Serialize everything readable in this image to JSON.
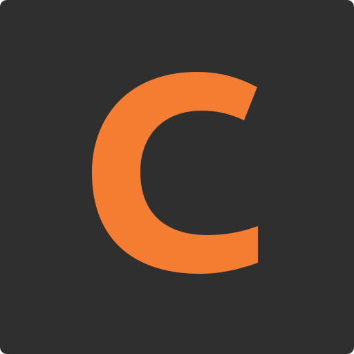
{
  "logo": {
    "letter": "C",
    "colors": {
      "background": "#2f2f2f",
      "letter": "#f47d31"
    }
  }
}
